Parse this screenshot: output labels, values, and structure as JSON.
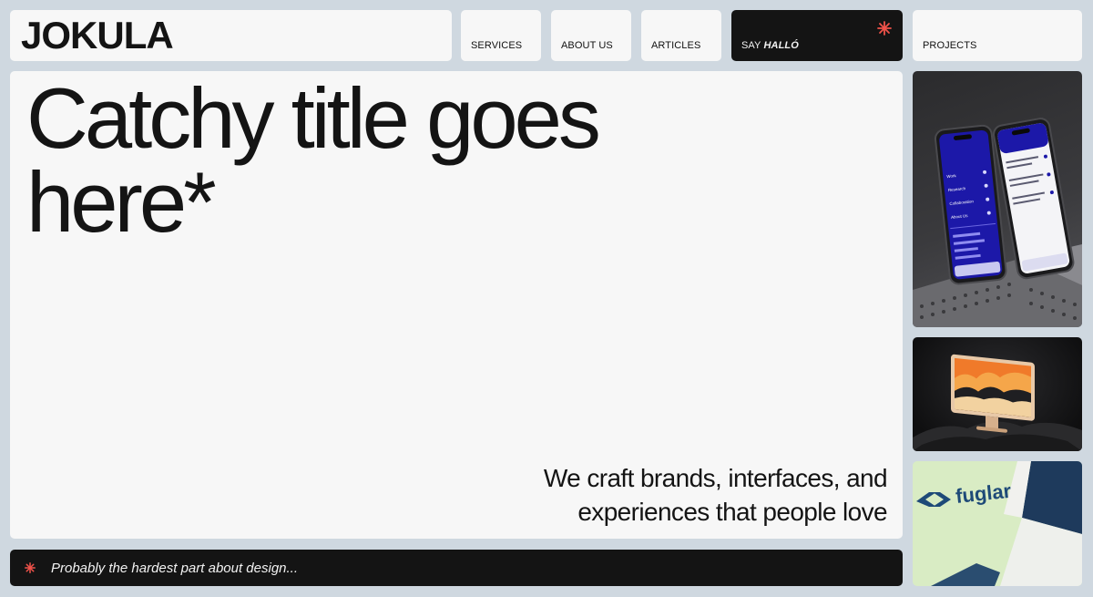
{
  "brand": {
    "logo_text": "JOKULA"
  },
  "nav": {
    "services": "SERVICES",
    "about": "ABOUT US",
    "articles": "ARTICLES",
    "say_prefix": "SAY",
    "say_word": "HALLÓ",
    "projects": "PROJECTS"
  },
  "hero": {
    "title_line1": "Catchy title goes",
    "title_line2": "here*",
    "subtitle_line1": "We craft brands, interfaces, and",
    "subtitle_line2": "experiences that people love"
  },
  "banner": {
    "text": "Probably the hardest part about design..."
  },
  "projects": {
    "fuglar_logo": "fuglar",
    "phone_menu": [
      "Work",
      "Research",
      "Collaboration",
      "About Us"
    ]
  },
  "colors": {
    "accent": "#f0524a",
    "dark": "#141414",
    "card": "#f7f7f7",
    "background": "#cfd8e0"
  },
  "icons": {
    "asterisk": "asterisk-icon"
  }
}
